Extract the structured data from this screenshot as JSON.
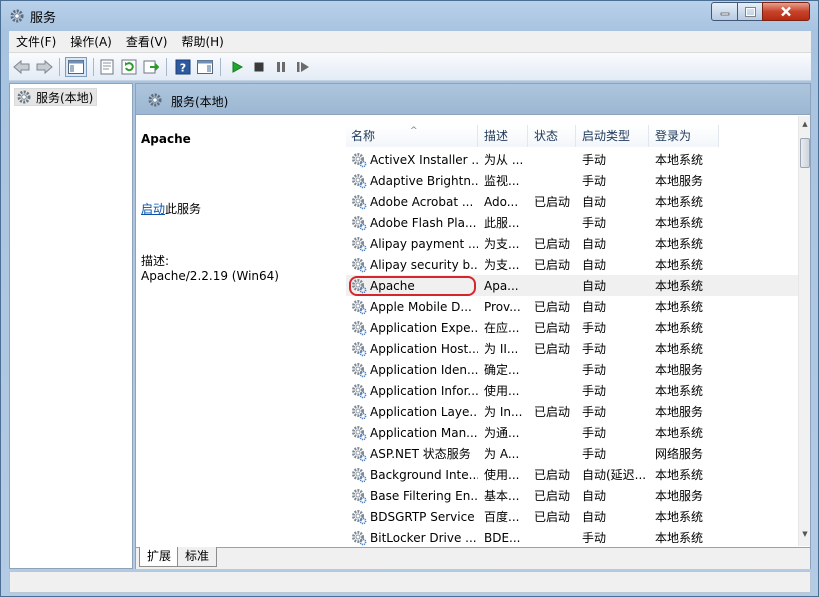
{
  "window": {
    "title": "服务"
  },
  "menu": [
    "文件(F)",
    "操作(A)",
    "查看(V)",
    "帮助(H)"
  ],
  "toolbar": [
    "back-icon",
    "forward-icon",
    "show-hide-tree-icon",
    "properties-icon",
    "refresh-icon",
    "export-list-icon",
    "help-icon",
    "show-hide-action-pane-icon",
    "start-service-icon",
    "stop-service-icon",
    "pause-service-icon",
    "resume-service-icon"
  ],
  "tree": {
    "node_label": "服务(本地)"
  },
  "pane": {
    "title": "服务(本地)"
  },
  "detail": {
    "service_name": "Apache",
    "start_link": "启动",
    "start_suffix": "此服务",
    "desc_label": "描述:",
    "desc_text": "Apache/2.2.19 (Win64)"
  },
  "columns": {
    "name": "名称",
    "desc": "描述",
    "status": "状态",
    "startup": "启动类型",
    "logon": "登录为"
  },
  "services": [
    {
      "name": "ActiveX Installer ...",
      "desc": "为从 ...",
      "status": "",
      "startup": "手动",
      "logon": "本地系统"
    },
    {
      "name": "Adaptive Brightn...",
      "desc": "监视...",
      "status": "",
      "startup": "手动",
      "logon": "本地服务"
    },
    {
      "name": "Adobe Acrobat ...",
      "desc": "Ado...",
      "status": "已启动",
      "startup": "自动",
      "logon": "本地系统"
    },
    {
      "name": "Adobe Flash Pla...",
      "desc": "此服...",
      "status": "",
      "startup": "手动",
      "logon": "本地系统"
    },
    {
      "name": "Alipay payment ...",
      "desc": "为支...",
      "status": "已启动",
      "startup": "自动",
      "logon": "本地系统"
    },
    {
      "name": "Alipay security b...",
      "desc": "为支...",
      "status": "已启动",
      "startup": "自动",
      "logon": "本地系统"
    },
    {
      "name": "Apache",
      "desc": "Apa...",
      "status": "",
      "startup": "自动",
      "logon": "本地系统"
    },
    {
      "name": "Apple Mobile D...",
      "desc": "Prov...",
      "status": "已启动",
      "startup": "自动",
      "logon": "本地系统"
    },
    {
      "name": "Application Expe...",
      "desc": "在应...",
      "status": "已启动",
      "startup": "手动",
      "logon": "本地系统"
    },
    {
      "name": "Application Host...",
      "desc": "为 II...",
      "status": "已启动",
      "startup": "手动",
      "logon": "本地系统"
    },
    {
      "name": "Application Iden...",
      "desc": "确定...",
      "status": "",
      "startup": "手动",
      "logon": "本地服务"
    },
    {
      "name": "Application Infor...",
      "desc": "使用...",
      "status": "",
      "startup": "手动",
      "logon": "本地系统"
    },
    {
      "name": "Application Laye...",
      "desc": "为 In...",
      "status": "已启动",
      "startup": "手动",
      "logon": "本地服务"
    },
    {
      "name": "Application Man...",
      "desc": "为通...",
      "status": "",
      "startup": "手动",
      "logon": "本地系统"
    },
    {
      "name": "ASP.NET 状态服务",
      "desc": "为 A...",
      "status": "",
      "startup": "手动",
      "logon": "网络服务"
    },
    {
      "name": "Background Inte...",
      "desc": "使用...",
      "status": "已启动",
      "startup": "自动(延迟...",
      "logon": "本地系统"
    },
    {
      "name": "Base Filtering En...",
      "desc": "基本...",
      "status": "已启动",
      "startup": "自动",
      "logon": "本地服务"
    },
    {
      "name": "BDSGRTP Service",
      "desc": "百度...",
      "status": "已启动",
      "startup": "自动",
      "logon": "本地系统"
    },
    {
      "name": "BitLocker Drive ...",
      "desc": "BDE...",
      "status": "",
      "startup": "手动",
      "logon": "本地系统"
    }
  ],
  "selected_row": 6,
  "tabs": [
    "扩展",
    "标准"
  ]
}
